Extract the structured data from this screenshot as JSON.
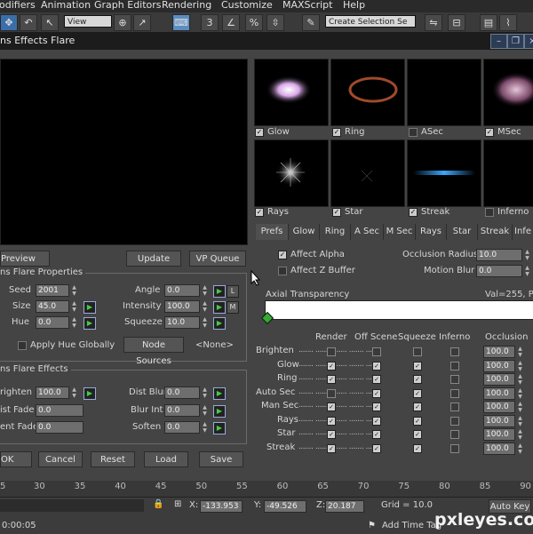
{
  "menu": [
    "odifiers",
    "Animation",
    "Graph Editors",
    "Rendering",
    "Customize",
    "MAXScript",
    "Help"
  ],
  "toolbar": {
    "view_dropdown": "View",
    "selection_set": "Create Selection Se",
    "num_3": "3",
    "percent": "%"
  },
  "window": {
    "title": "ns Effects Flare"
  },
  "thumbs": [
    {
      "label": "Glow",
      "checked": true
    },
    {
      "label": "Ring",
      "checked": true
    },
    {
      "label": "ASec",
      "checked": false
    },
    {
      "label": "MSec",
      "checked": true
    },
    {
      "label": "Rays",
      "checked": true
    },
    {
      "label": "Star",
      "checked": true
    },
    {
      "label": "Streak",
      "checked": true
    },
    {
      "label": "Inferno",
      "checked": false
    }
  ],
  "buttons": {
    "preview": "Preview",
    "update": "Update",
    "vp_queue": "VP Queue",
    "node_sources": "Node Sources",
    "none": "<None>",
    "ok": "OK",
    "cancel": "Cancel",
    "reset": "Reset",
    "load": "Load",
    "save": "Save"
  },
  "props": {
    "title": "ns Flare Properties",
    "seed_label": "Seed",
    "seed": "2001",
    "size_label": "Size",
    "size": "45.0",
    "hue_label": "Hue",
    "hue": "0.0",
    "angle_label": "Angle",
    "angle": "0.0",
    "intensity_label": "Intensity",
    "intensity": "100.0",
    "squeeze_label": "Squeeze",
    "squeeze": "10.0",
    "l": "L",
    "m": "M",
    "apply_hue": "Apply Hue Globally"
  },
  "effects": {
    "title": "ns Flare Effects",
    "brighten_label": "righten",
    "brighten": "100.0",
    "dist_fade_label": "ist Fade",
    "dist_fade": "0.0",
    "cent_fade_label": "ent Fade",
    "cent_fade": "0.0",
    "dist_blur_label": "Dist Blur",
    "dist_blur": "0.0",
    "blur_int_label": "Blur Int",
    "blur_int": "0.0",
    "soften_label": "Soften",
    "soften": "0.0"
  },
  "tabs": [
    "Prefs",
    "Glow",
    "Ring",
    "A Sec",
    "M Sec",
    "Rays",
    "Star",
    "Streak",
    "Infe"
  ],
  "prefs": {
    "affect_alpha": "Affect Alpha",
    "affect_z": "Affect Z Buffer",
    "occlusion_radius_label": "Occlusion Radius",
    "occlusion_radius": "10.0",
    "motion_blur_label": "Motion Blur",
    "motion_blur": "0.0",
    "axial_label": "Axial Transparency",
    "val_readout": "Val=255, Pos"
  },
  "table": {
    "headers": [
      "Render",
      "Off Scene",
      "Squeeze",
      "Inferno",
      "Occlusion"
    ],
    "rows": [
      {
        "label": "Brighten",
        "render": false,
        "off": false,
        "squeeze": false,
        "inferno": false,
        "occ": "100.0"
      },
      {
        "label": "Glow",
        "render": true,
        "off": true,
        "squeeze": true,
        "inferno": false,
        "occ": "100.0"
      },
      {
        "label": "Ring",
        "render": true,
        "off": true,
        "squeeze": true,
        "inferno": false,
        "occ": "100.0"
      },
      {
        "label": "Auto Sec",
        "render": false,
        "off": true,
        "squeeze": true,
        "inferno": false,
        "occ": "100.0"
      },
      {
        "label": "Man Sec",
        "render": true,
        "off": true,
        "squeeze": true,
        "inferno": false,
        "occ": "100.0"
      },
      {
        "label": "Rays",
        "render": true,
        "off": true,
        "squeeze": true,
        "inferno": false,
        "occ": "100.0"
      },
      {
        "label": "Star",
        "render": true,
        "off": true,
        "squeeze": true,
        "inferno": false,
        "occ": "100.0"
      },
      {
        "label": "Streak",
        "render": true,
        "off": true,
        "squeeze": true,
        "inferno": false,
        "occ": "100.0"
      }
    ]
  },
  "timeline": {
    "ticks": [
      "5",
      "30",
      "35",
      "40",
      "45",
      "50",
      "55",
      "60",
      "65",
      "70",
      "75",
      "80",
      "85",
      "90"
    ]
  },
  "status": {
    "x_label": "X:",
    "x": "-133.953",
    "y_label": "Y:",
    "y": "-49.526",
    "z_label": "Z:",
    "z": "20.187",
    "grid": "Grid = 10.0",
    "auto_key": "Auto Key",
    "time": "0:00:05",
    "add_time_tag": "Add Time Tag",
    "watermark": "pxleyes.com"
  }
}
